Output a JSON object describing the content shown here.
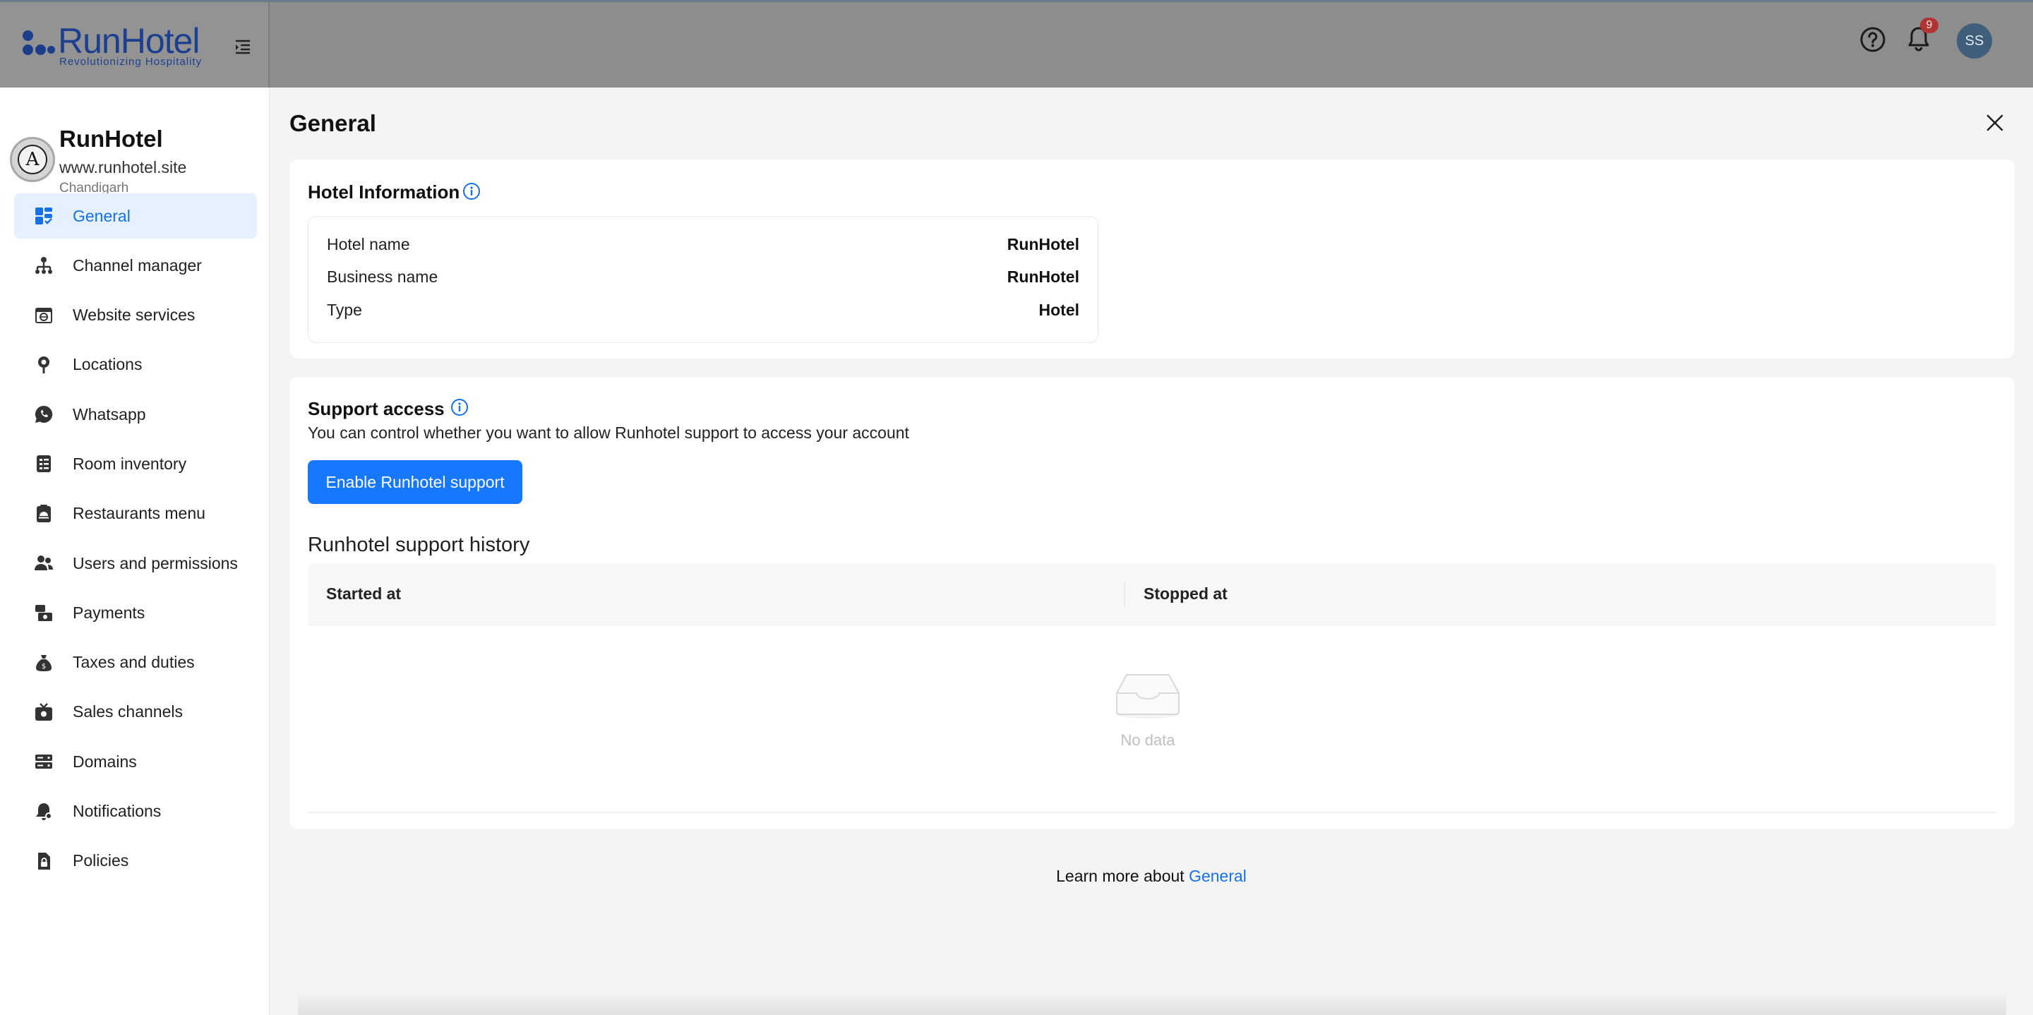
{
  "app": {
    "brand_name": "RunHotel",
    "brand_tagline": "Revolutionizing Hospitality",
    "brand_color": "#1c3f8f"
  },
  "topbar": {
    "notification_count": "9",
    "avatar_initials": "SS",
    "icons": [
      "menu-collapse-icon",
      "help-icon",
      "bell-icon"
    ]
  },
  "hotel": {
    "name": "RunHotel",
    "website": "www.runhotel.site",
    "city": "Chandigarh",
    "logo_letter": "A"
  },
  "sidebar": {
    "active_index": 0,
    "accent_color": "#1670e6",
    "items": [
      {
        "label": "General",
        "icon": "dashboard-icon"
      },
      {
        "label": "Channel manager",
        "icon": "hierarchy-icon"
      },
      {
        "label": "Website services",
        "icon": "browser-icon"
      },
      {
        "label": "Locations",
        "icon": "location-pin-icon"
      },
      {
        "label": "Whatsapp",
        "icon": "whatsapp-icon"
      },
      {
        "label": "Room inventory",
        "icon": "checklist-icon"
      },
      {
        "label": "Restaurants menu",
        "icon": "clipboard-food-icon"
      },
      {
        "label": "Users and permissions",
        "icon": "users-icon"
      },
      {
        "label": "Payments",
        "icon": "payments-icon"
      },
      {
        "label": "Taxes and duties",
        "icon": "tax-bag-icon"
      },
      {
        "label": "Sales channels",
        "icon": "tv-channel-icon"
      },
      {
        "label": "Domains",
        "icon": "server-icon"
      },
      {
        "label": "Notifications",
        "icon": "bell-settings-icon"
      },
      {
        "label": "Policies",
        "icon": "document-lock-icon"
      }
    ]
  },
  "main": {
    "title": "General",
    "hotel_info": {
      "title": "Hotel Information",
      "rows": [
        {
          "key": "Hotel name",
          "value": "RunHotel"
        },
        {
          "key": "Business name",
          "value": "RunHotel"
        },
        {
          "key": "Type",
          "value": "Hotel"
        }
      ]
    },
    "support": {
      "title": "Support access",
      "description": "You can control whether you want to allow Runhotel support to access your account",
      "button_label": "Enable Runhotel support",
      "button_color": "#1677ff",
      "history_title": "Runhotel support history",
      "columns": [
        "Started at",
        "Stopped at"
      ],
      "empty_text": "No data"
    },
    "learn_more": {
      "prefix": "Learn more about ",
      "link": "General"
    }
  }
}
